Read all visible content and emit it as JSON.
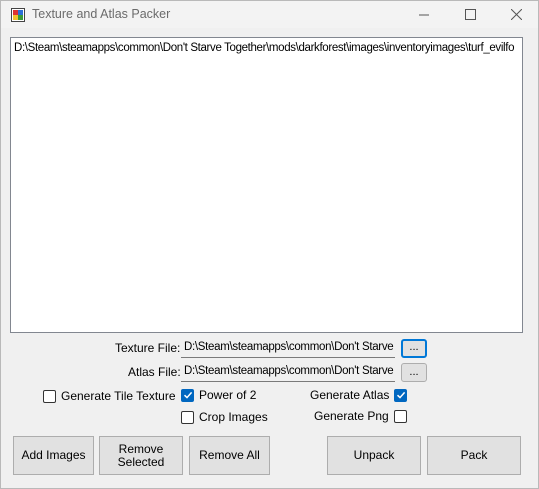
{
  "window": {
    "title": "Texture and Atlas Packer",
    "minimize_icon": "minimize-icon",
    "maximize_icon": "maximize-icon",
    "close_icon": "close-icon",
    "app_icon": "app-icon"
  },
  "file_list": {
    "items": [
      "D:\\Steam\\steamapps\\common\\Don't Starve Together\\mods\\darkforest\\images\\inventoryimages\\turf_evilfo"
    ]
  },
  "texture_file": {
    "label": "Texture File:",
    "value": "D:\\Steam\\steamapps\\common\\Don't Starve",
    "browse_label": "..."
  },
  "atlas_file": {
    "label": "Atlas File:",
    "value": "D:\\Steam\\steamapps\\common\\Don't Starve",
    "browse_label": "..."
  },
  "options": {
    "generate_tile_texture": {
      "label": "Generate Tile Texture",
      "checked": false
    },
    "power_of_2": {
      "label": "Power of 2",
      "checked": true
    },
    "crop_images": {
      "label": "Crop Images",
      "checked": false
    },
    "generate_atlas": {
      "label": "Generate Atlas",
      "checked": true
    },
    "generate_png": {
      "label": "Generate Png",
      "checked": false
    }
  },
  "buttons": {
    "add_images": "Add Images",
    "remove_selected": "Remove Selected",
    "remove_all": "Remove All",
    "unpack": "Unpack",
    "pack": "Pack"
  },
  "colors": {
    "accent": "#0067c0",
    "focus": "#0078d7",
    "window_bg": "#f0f0f0",
    "button_bg": "#e1e1e1"
  }
}
